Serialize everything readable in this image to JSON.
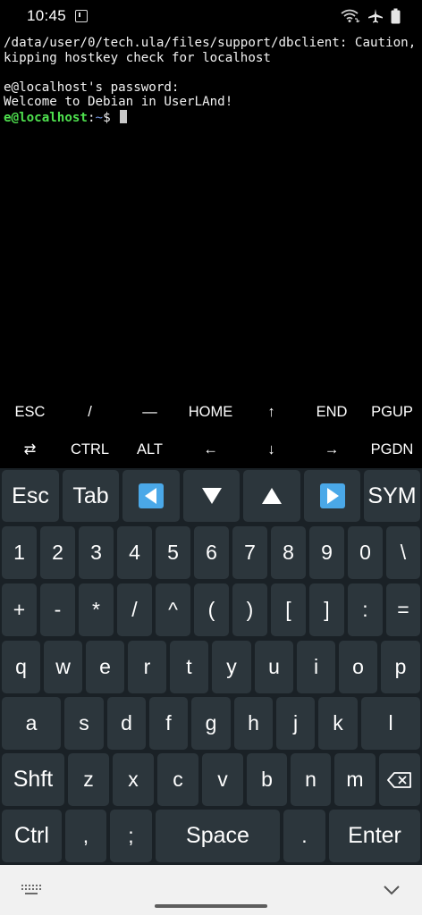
{
  "status_bar": {
    "time": "10:45"
  },
  "terminal": {
    "lines": [
      "/data/user/0/tech.ula/files/support/dbclient: Caution, s",
      "kipping hostkey check for localhost",
      "",
      "e@localhost's password:",
      "Welcome to Debian in UserLAnd!"
    ],
    "prompt": {
      "user_host": "e@localhost",
      "colon": ":",
      "path": "~",
      "symbol": "$ "
    }
  },
  "extra_keys": {
    "row1": [
      "ESC",
      "/",
      "—",
      "HOME",
      "↑",
      "END",
      "PGUP"
    ],
    "row2": [
      "⇄",
      "CTRL",
      "ALT",
      "←",
      "↓",
      "→",
      "PGDN"
    ]
  },
  "keyboard": {
    "row1": [
      "Esc",
      "Tab",
      "◀",
      "▼",
      "▲",
      "▶",
      "SYM"
    ],
    "row2": [
      "1",
      "2",
      "3",
      "4",
      "5",
      "6",
      "7",
      "8",
      "9",
      "0",
      "\\"
    ],
    "row3": [
      "+",
      "-",
      "*",
      "/",
      "^",
      "(",
      ")",
      "[",
      "]",
      ":",
      "="
    ],
    "row4": [
      "q",
      "w",
      "e",
      "r",
      "t",
      "y",
      "u",
      "i",
      "o",
      "p"
    ],
    "row5": [
      "a",
      "s",
      "d",
      "f",
      "g",
      "h",
      "j",
      "k",
      "l"
    ],
    "row6": [
      "Shft",
      "z",
      "x",
      "c",
      "v",
      "b",
      "n",
      "m",
      "⌫"
    ],
    "row7": [
      "Ctrl",
      ",",
      ";",
      "Space",
      ".",
      "Enter"
    ]
  },
  "colors": {
    "terminal_bg": "#000000",
    "prompt_user": "#4ee04e",
    "prompt_path": "#6f8fd6",
    "keyboard_bg": "#1a2126",
    "key_bg": "#2c363c",
    "arrow_key_blue": "#4aa8e8",
    "navbar_bg": "#f1f1f1"
  }
}
